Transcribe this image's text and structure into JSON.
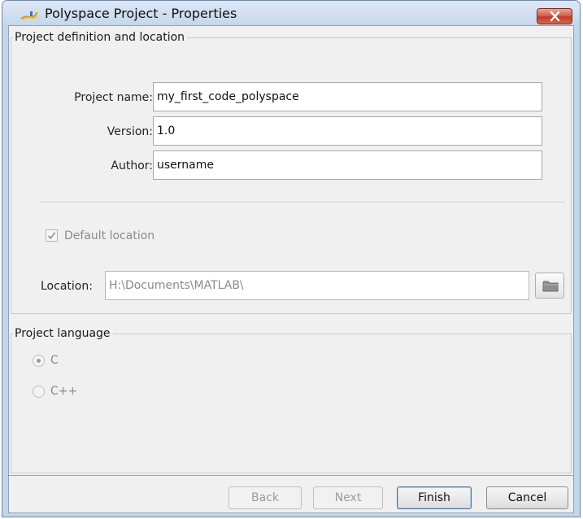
{
  "window": {
    "title": "Polyspace Project - Properties",
    "close_icon": "close-icon"
  },
  "definition": {
    "legend": "Project definition and location",
    "project_name_label": "Project name:",
    "project_name_value": "my_first_code_polyspace",
    "version_label": "Version:",
    "version_value": "1.0",
    "author_label": "Author:",
    "author_value": "username",
    "default_location_label": "Default location",
    "default_location_checked": true,
    "location_label": "Location:",
    "location_value": "H:\\Documents\\MATLAB\\",
    "browse_icon": "folder-icon"
  },
  "language": {
    "legend": "Project language",
    "options": [
      {
        "label": "C",
        "selected": true
      },
      {
        "label": "C++",
        "selected": false
      }
    ]
  },
  "buttons": {
    "back": "Back",
    "next": "Next",
    "finish": "Finish",
    "cancel": "Cancel"
  },
  "colors": {
    "close_button": "#c23a25",
    "window_frame": "#c4d5ea",
    "dialog_background": "#f0f0f0"
  }
}
